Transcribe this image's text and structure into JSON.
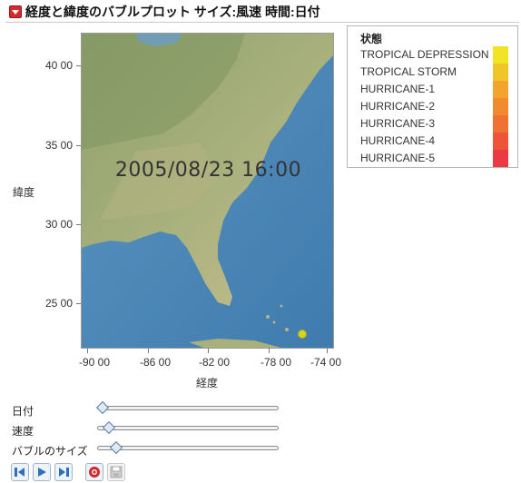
{
  "title": "経度と緯度のバブルプロット サイズ:風速  時間:日付",
  "map": {
    "timestamp": "2005/08/23 16:00",
    "y_axis_label": "緯度",
    "x_axis_label": "経度",
    "y_ticks": [
      "40 00",
      "35 00",
      "30 00",
      "25 00"
    ],
    "x_ticks": [
      "-90 00",
      "-86 00",
      "-82 00",
      "-78 00",
      "-74 00"
    ],
    "point_color": "#d7d424"
  },
  "legend": {
    "title": "状態",
    "items": [
      {
        "label": "TROPICAL DEPRESSION",
        "color": "#f1e424"
      },
      {
        "label": "TROPICAL STORM",
        "color": "#efc52a"
      },
      {
        "label": "HURRICANE-1",
        "color": "#f2a42e"
      },
      {
        "label": "HURRICANE-2",
        "color": "#f08b30"
      },
      {
        "label": "HURRICANE-3",
        "color": "#ef7134"
      },
      {
        "label": "HURRICANE-4",
        "color": "#ee5538"
      },
      {
        "label": "HURRICANE-5",
        "color": "#ec3a45"
      }
    ]
  },
  "controls": {
    "date_label": "日付",
    "speed_label": "速度",
    "bubble_size_label": "バブルのサイズ",
    "date_slider_fraction": 0.0,
    "speed_slider_fraction": 0.04,
    "bubble_size_slider_fraction": 0.08
  },
  "buttons": {
    "step_back": "step-back-icon",
    "play": "play-icon",
    "step_forward": "step-forward-icon",
    "record": "record-icon",
    "save": "save-icon"
  }
}
